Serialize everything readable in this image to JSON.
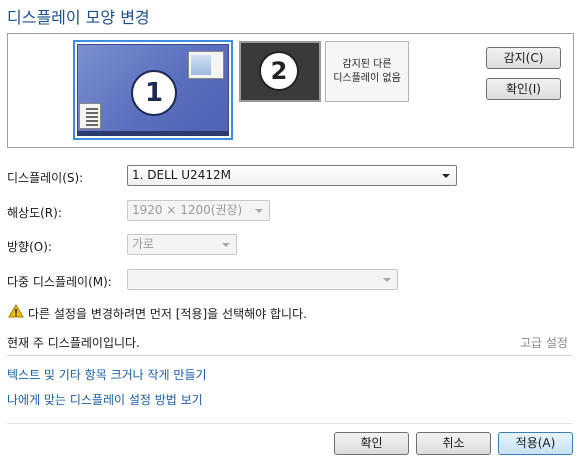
{
  "title": "디스플레이 모양 변경",
  "preview": {
    "monitor1_number": "1",
    "monitor2_number": "2",
    "monitor3_text_line1": "감지된 다른",
    "monitor3_text_line2": "디스플레이 없음",
    "detect_button": "감지(C)",
    "identify_button": "확인(I)"
  },
  "settings": {
    "display_label": "디스플레이(S):",
    "display_value": "1. DELL U2412M",
    "resolution_label": "해상도(R):",
    "resolution_value": "1920 × 1200(권장)",
    "orientation_label": "방향(O):",
    "orientation_value": "가로",
    "multi_label": "다중 디스플레이(M):",
    "multi_value": ""
  },
  "warning_text": "다른 설정을 변경하려면 먼저 [적용]을 선택해야 합니다.",
  "main_display_text": "현재 주 디스플레이입니다.",
  "advanced_link": "고급 설정",
  "links": {
    "text_size": "텍스트 및 기타 항목 크거나 작게 만들기",
    "help": "나에게 맞는 디스플레이 설정 방법 보기"
  },
  "buttons": {
    "ok": "확인",
    "cancel": "취소",
    "apply": "적용(A)"
  },
  "colors": {
    "title": "#1f4f8f",
    "link": "#1a5ea8",
    "selection": "#3d8ee3",
    "warning": "#f2c200"
  }
}
